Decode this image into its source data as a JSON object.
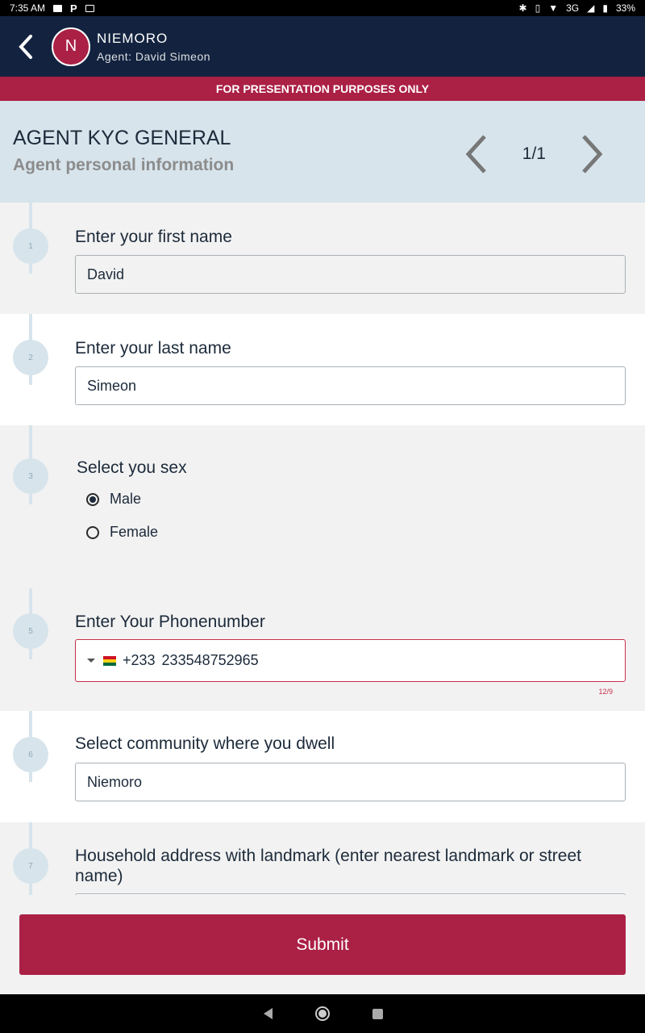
{
  "status_bar": {
    "time": "7:35 AM",
    "network": "3G",
    "battery": "33%"
  },
  "header": {
    "avatar_letter": "N",
    "title": "NIEMORO",
    "subtitle": "Agent: David Simeon"
  },
  "banner": "FOR PRESENTATION PURPOSES ONLY",
  "section": {
    "title": "AGENT KYC GENERAL",
    "subtitle": "Agent personal information",
    "page": "1/1"
  },
  "questions": {
    "first_name": {
      "number": "1",
      "label": "Enter your first name",
      "value": "David"
    },
    "last_name": {
      "number": "2",
      "label": "Enter your last name",
      "value": "Simeon"
    },
    "sex": {
      "number": "3",
      "label": "Select you sex",
      "options": [
        "Male",
        "Female"
      ],
      "selected": "Male"
    },
    "phone": {
      "number": "5",
      "label": "Enter Your Phonenumber",
      "country_code": "+233",
      "value": "233548752965",
      "counter": "12/9"
    },
    "community": {
      "number": "6",
      "label": "Select community where you dwell",
      "value": "Niemoro"
    },
    "address": {
      "number": "7",
      "label": "Household address with landmark (enter nearest landmark or street name)"
    }
  },
  "submit_label": "Submit",
  "colors": {
    "primary": "#ab2045",
    "header": "#13233f",
    "section_bg": "#d7e4ec"
  }
}
